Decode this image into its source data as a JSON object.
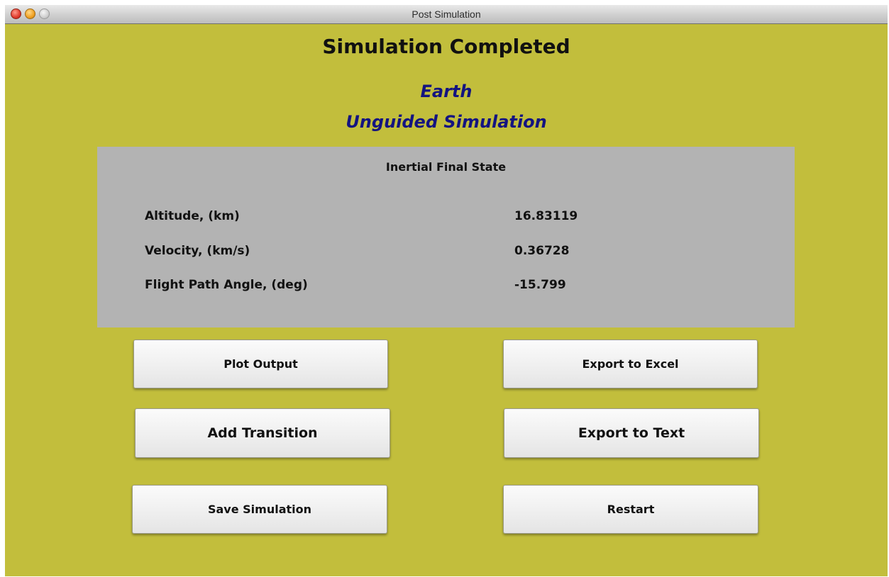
{
  "window": {
    "title": "Post Simulation"
  },
  "header": {
    "title": "Simulation Completed",
    "planet": "Earth",
    "mode": "Unguided Simulation"
  },
  "final_state": {
    "title": "Inertial Final State",
    "rows": [
      {
        "label": "Altitude, (km)",
        "value": "16.83119"
      },
      {
        "label": "Velocity,  (km/s)",
        "value": "0.36728"
      },
      {
        "label": "Flight Path Angle,  (deg)",
        "value": "-15.799"
      }
    ]
  },
  "buttons": {
    "plot_output": "Plot Output",
    "export_excel": "Export to Excel",
    "add_transition": "Add Transition",
    "export_text": "Export to Text",
    "save_simulation": "Save Simulation",
    "restart": "Restart"
  },
  "colors": {
    "window_background": "#c2be3c",
    "panel_background": "#b3b3b3",
    "subtitle_text": "#141480"
  }
}
